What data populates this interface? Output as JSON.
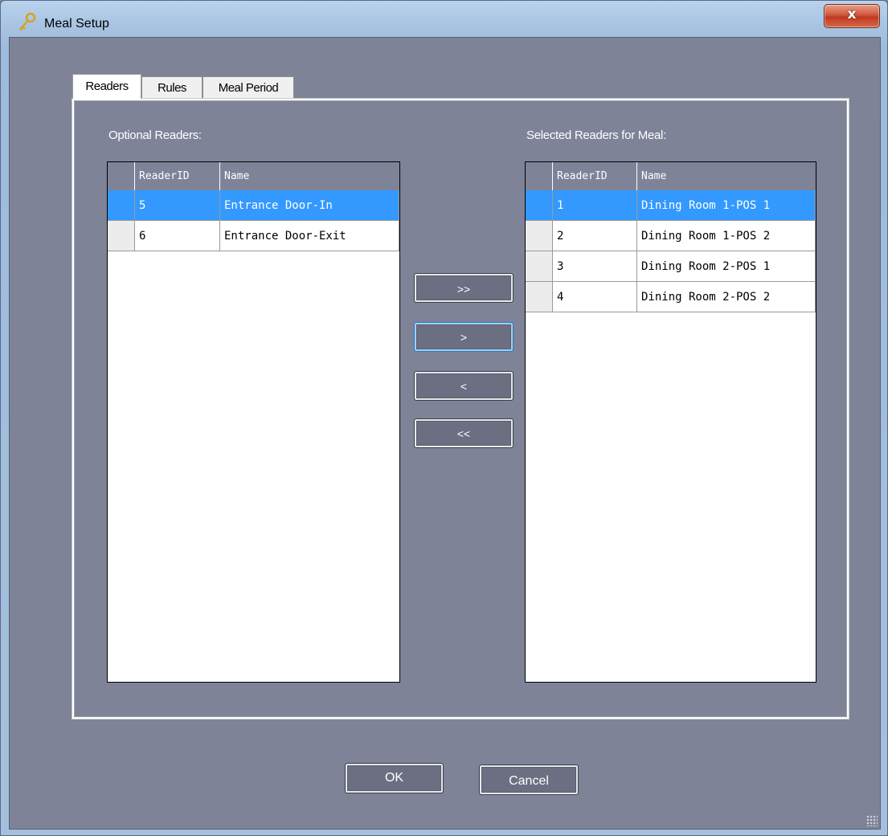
{
  "window": {
    "title": "Meal Setup",
    "close_label": "x"
  },
  "tabs": [
    {
      "label": "Readers",
      "active": true
    },
    {
      "label": "Rules",
      "active": false
    },
    {
      "label": "Meal Period",
      "active": false
    }
  ],
  "optional_readers": {
    "label": "Optional Readers:",
    "columns": [
      "ReaderID",
      "Name"
    ],
    "rows": [
      {
        "id": "5",
        "name": "Entrance Door-In",
        "selected": true
      },
      {
        "id": "6",
        "name": "Entrance Door-Exit",
        "selected": false
      }
    ]
  },
  "selected_readers": {
    "label": "Selected Readers for Meal:",
    "columns": [
      "ReaderID",
      "Name"
    ],
    "rows": [
      {
        "id": "1",
        "name": "Dining Room 1-POS 1",
        "selected": true
      },
      {
        "id": "2",
        "name": "Dining Room 1-POS 2",
        "selected": false
      },
      {
        "id": "3",
        "name": "Dining Room 2-POS 1",
        "selected": false
      },
      {
        "id": "4",
        "name": "Dining Room 2-POS 2",
        "selected": false
      }
    ]
  },
  "transfer_buttons": {
    "add_all": ">>",
    "add_one": ">",
    "remove_one": "<",
    "remove_all": "<<"
  },
  "footer": {
    "ok_label": "OK",
    "cancel_label": "Cancel"
  }
}
